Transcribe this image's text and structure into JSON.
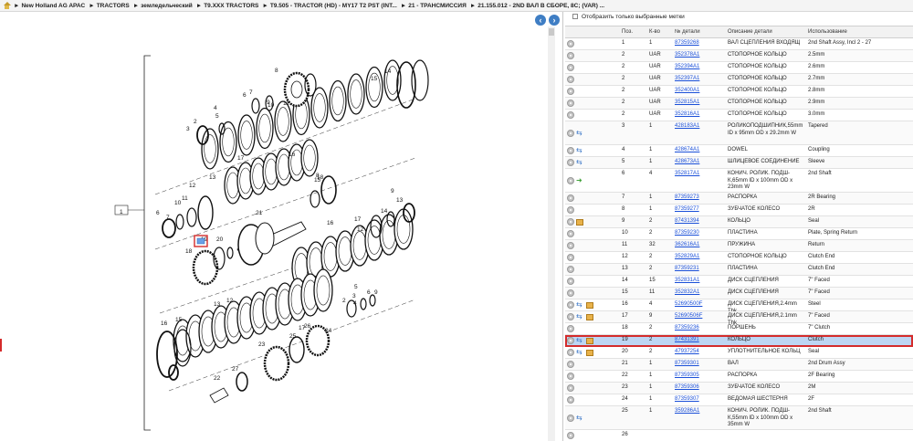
{
  "breadcrumb": {
    "items": [
      "New Holland AG APAC",
      "TRACTORS",
      "земледельческий",
      "T9.XXX TRACTORS",
      "T9.505 - TRACTOR (HD) - MY17 T2 PST (INT...",
      "21 - ТРАНСМИССИЯ",
      "21.155.012 - 2ND ВАЛ В СБОРЕ, 8С; (VAR) ..."
    ]
  },
  "filter": {
    "label": "Отобразить только выбранные метки"
  },
  "table": {
    "headers": {
      "pos": "Поз.",
      "qty": "К-во",
      "num": "№ детали",
      "desc": "Описание детали",
      "use": "Использование"
    },
    "rows": [
      {
        "pos": "1",
        "qty": "1",
        "num": "87359268",
        "desc": "ВАЛ СЦЕПЛЕНИЯ ВХОДЯЩ",
        "use": "2nd Shaft Assy, Incl 2 - 27",
        "icons": [
          "g"
        ]
      },
      {
        "pos": "2",
        "qty": "UAR",
        "num": "352378A1",
        "desc": "СТОПОРНОЕ КОЛЬЦО",
        "use": "2.5mm",
        "icons": [
          "g"
        ]
      },
      {
        "pos": "2",
        "qty": "UAR",
        "num": "352394A1",
        "desc": "СТОПОРНОЕ КОЛЬЦО",
        "use": "2.6mm",
        "icons": [
          "g"
        ]
      },
      {
        "pos": "2",
        "qty": "UAR",
        "num": "352397A1",
        "desc": "СТОПОРНОЕ КОЛЬЦО",
        "use": "2.7mm",
        "icons": [
          "g"
        ]
      },
      {
        "pos": "2",
        "qty": "UAR",
        "num": "352400A1",
        "desc": "СТОПОРНОЕ КОЛЬЦО",
        "use": "2.8mm",
        "icons": [
          "g"
        ]
      },
      {
        "pos": "2",
        "qty": "UAR",
        "num": "352815A1",
        "desc": "СТОПОРНОЕ КОЛЬЦО",
        "use": "2.9mm",
        "icons": [
          "g"
        ]
      },
      {
        "pos": "2",
        "qty": "UAR",
        "num": "352816A1",
        "desc": "СТОПОРНОЕ КОЛЬЦО",
        "use": "3.0mm",
        "icons": [
          "g"
        ]
      },
      {
        "pos": "3",
        "qty": "1",
        "num": "428183A1",
        "desc": "РОЛИКОПОДШИПНИК,55mm ID x 95mm OD x 29.2mm W",
        "use": "Tapered",
        "icons": [
          "g",
          "s"
        ]
      },
      {
        "pos": "4",
        "qty": "1",
        "num": "428674A1",
        "desc": "DOWEL",
        "use": "Coupling",
        "icons": [
          "g",
          "s"
        ]
      },
      {
        "pos": "5",
        "qty": "1",
        "num": "428673A1",
        "desc": "ШЛИЦЕВОЕ СОЕДИНЕНИЕ",
        "use": "Sleeve",
        "icons": [
          "g",
          "s"
        ]
      },
      {
        "pos": "6",
        "qty": "4",
        "num": "352817A1",
        "desc": "КОНИЧ. РОЛИК. ПОДШ-К,65mm ID x 100mm OD x 23mm W",
        "use": "2nd Shaft",
        "icons": [
          "g",
          "gr"
        ]
      },
      {
        "pos": "7",
        "qty": "1",
        "num": "87359273",
        "desc": "РАСПОРКА",
        "use": "2R Bearing",
        "icons": [
          "g"
        ]
      },
      {
        "pos": "8",
        "qty": "1",
        "num": "87359277",
        "desc": "ЗУБЧАТОЕ КОЛЕСО",
        "use": "2R",
        "icons": [
          "g"
        ]
      },
      {
        "pos": "9",
        "qty": "2",
        "num": "87431394",
        "desc": "КОЛЬЦО",
        "use": "Seal",
        "icons": [
          "g",
          "b"
        ]
      },
      {
        "pos": "10",
        "qty": "2",
        "num": "87359230",
        "desc": "ПЛАСТИНА",
        "use": "Plate, Spring Return",
        "icons": [
          "g"
        ]
      },
      {
        "pos": "11",
        "qty": "32",
        "num": "362616A1",
        "desc": "ПРУЖИНА",
        "use": "Return",
        "icons": [
          "g"
        ]
      },
      {
        "pos": "12",
        "qty": "2",
        "num": "352829A1",
        "desc": "СТОПОРНОЕ КОЛЬЦО",
        "use": "Clutch End",
        "icons": [
          "g"
        ]
      },
      {
        "pos": "13",
        "qty": "2",
        "num": "87359231",
        "desc": "ПЛАСТИНА",
        "use": "Clutch End",
        "icons": [
          "g"
        ]
      },
      {
        "pos": "14",
        "qty": "15",
        "num": "352831A1",
        "desc": "ДИСК СЦЕПЛЕНИЯ",
        "use": "7\" Faced",
        "icons": [
          "g"
        ]
      },
      {
        "pos": "15",
        "qty": "11",
        "num": "352832A1",
        "desc": "ДИСК СЦЕПЛЕНИЯ",
        "use": "7\" Faced",
        "icons": [
          "g"
        ]
      },
      {
        "pos": "16",
        "qty": "4",
        "num": "52690500F",
        "desc": "ДИСК СЦЕПЛЕНИЯ,2.4mm Thk",
        "use": "Steel",
        "icons": [
          "g",
          "s",
          "b"
        ]
      },
      {
        "pos": "17",
        "qty": "9",
        "num": "52690506F",
        "desc": "ДИСК СЦЕПЛЕНИЯ,2.1mm Thk",
        "use": "7\" Faced",
        "icons": [
          "g",
          "s",
          "b"
        ]
      },
      {
        "pos": "18",
        "qty": "2",
        "num": "87359236",
        "desc": "ПОРШЕНЬ",
        "use": "7\" Clutch",
        "icons": [
          "g"
        ]
      },
      {
        "pos": "19",
        "qty": "2",
        "num": "87431391",
        "desc": "КОЛЬЦО",
        "use": "Clutch",
        "icons": [
          "g",
          "s",
          "b"
        ],
        "selected": true
      },
      {
        "pos": "20",
        "qty": "2",
        "num": "47937254",
        "desc": "УПЛОТНИТЕЛЬНОЕ КОЛЬЦ",
        "use": "Seal",
        "icons": [
          "g",
          "s",
          "b"
        ]
      },
      {
        "pos": "21",
        "qty": "1",
        "num": "87359301",
        "desc": "ВАЛ",
        "use": "2nd Drum Assy",
        "icons": [
          "g"
        ]
      },
      {
        "pos": "22",
        "qty": "1",
        "num": "87359305",
        "desc": "РАСПОРКА",
        "use": "2F Bearing",
        "icons": [
          "g"
        ]
      },
      {
        "pos": "23",
        "qty": "1",
        "num": "87359306",
        "desc": "ЗУБЧАТОЕ КОЛЕСО",
        "use": "2M",
        "icons": [
          "g"
        ]
      },
      {
        "pos": "24",
        "qty": "1",
        "num": "87359307",
        "desc": "ВЕДОМАЯ ШЕСТЕРНЯ",
        "use": "2F",
        "icons": [
          "g"
        ]
      },
      {
        "pos": "25",
        "qty": "1",
        "num": "359286A1",
        "desc": "КОНИЧ. РОЛИК. ПОДШ-К,55mm ID x 100mm OD x 35mm W",
        "use": "2nd Shaft",
        "icons": [
          "g",
          "s"
        ]
      },
      {
        "pos": "26",
        "qty": "",
        "num": "",
        "desc": "",
        "use": "",
        "icons": [
          "g"
        ]
      }
    ]
  },
  "diagram": {
    "callouts": [
      "1",
      "2",
      "3",
      "4",
      "5",
      "6",
      "7",
      "8",
      "9",
      "10",
      "11",
      "12",
      "13",
      "14",
      "15",
      "16",
      "17",
      "18",
      "19",
      "20",
      "21",
      "22",
      "23",
      "24",
      "25",
      "26",
      "27"
    ],
    "highlighted_callout": "19"
  }
}
